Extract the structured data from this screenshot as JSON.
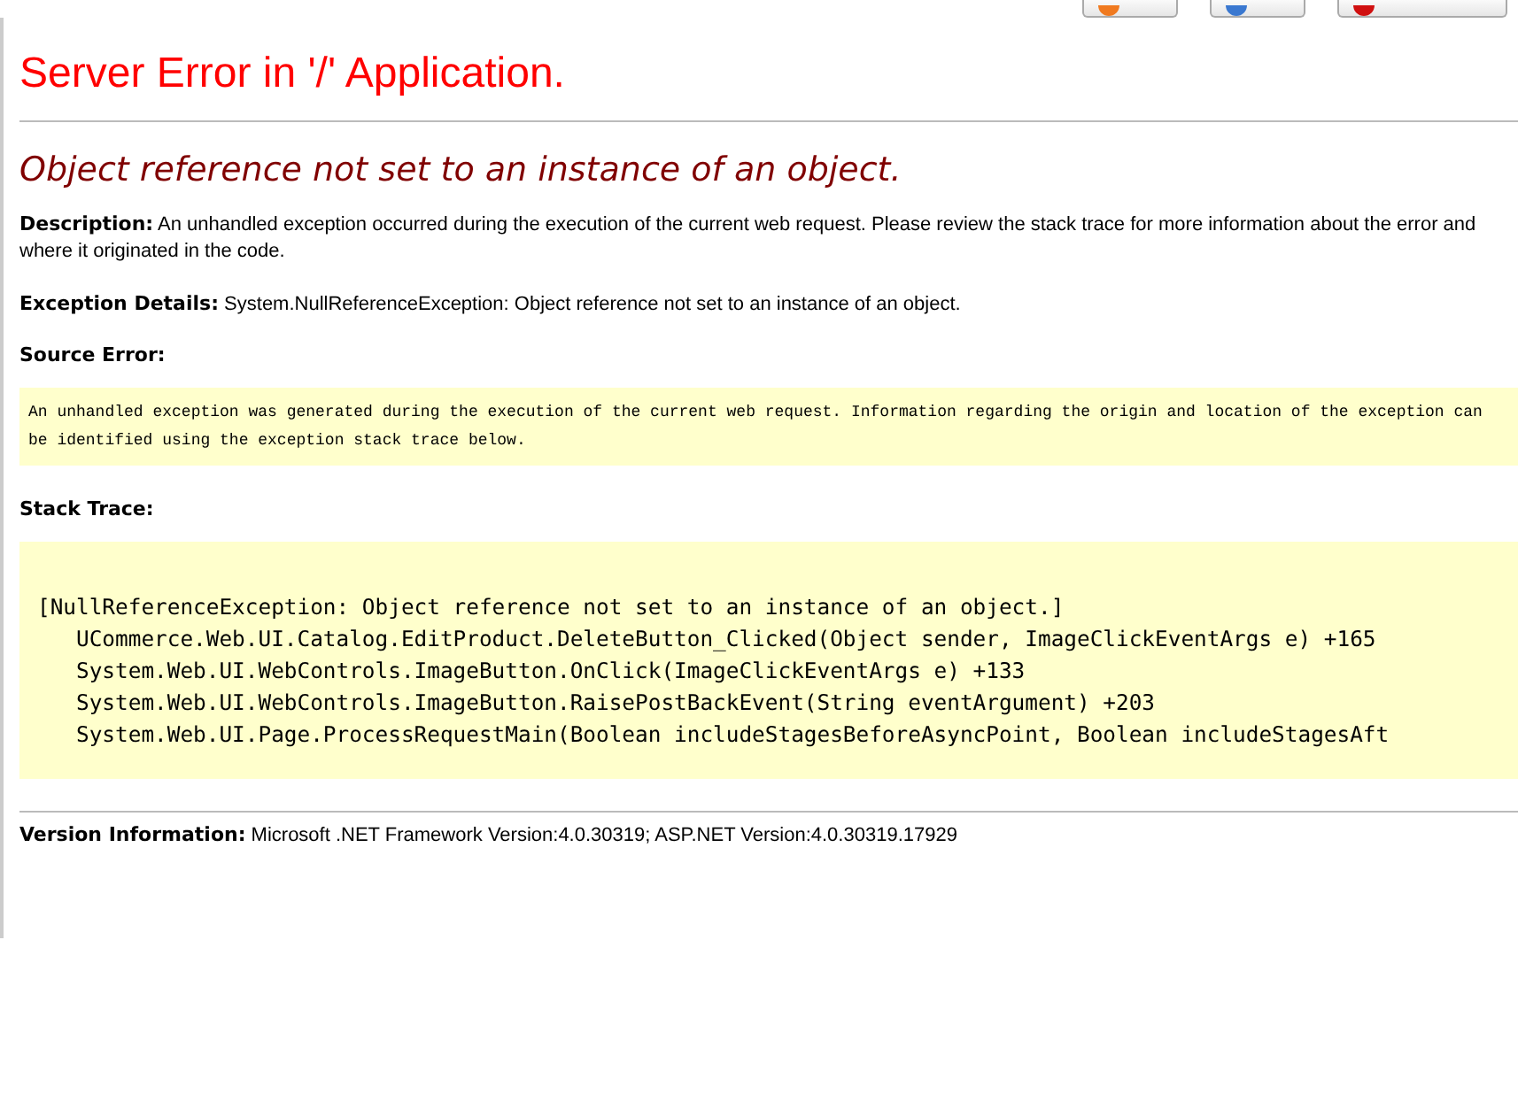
{
  "toolbar": {
    "buttons": [
      {
        "kind": "orange"
      },
      {
        "kind": "blue"
      },
      {
        "kind": "red"
      }
    ]
  },
  "title": "Server Error in '/' Application.",
  "message": "Object reference not set to an instance of an object.",
  "description": {
    "label": "Description:",
    "text": "An unhandled exception occurred during the execution of the current web request. Please review the stack trace for more information about the error and where it originated in the code."
  },
  "exception_details": {
    "label": "Exception Details:",
    "text": "System.NullReferenceException: Object reference not set to an instance of an object."
  },
  "source_error": {
    "label": "Source Error:",
    "text": "An unhandled exception was generated during the execution of the current web request. Information regarding the origin and location of the exception can be identified using the exception stack trace below."
  },
  "stack_trace": {
    "label": "Stack Trace:",
    "lines": [
      "[NullReferenceException: Object reference not set to an instance of an object.]",
      "   UCommerce.Web.UI.Catalog.EditProduct.DeleteButton_Clicked(Object sender, ImageClickEventArgs e) +165",
      "   System.Web.UI.WebControls.ImageButton.OnClick(ImageClickEventArgs e) +133",
      "   System.Web.UI.WebControls.ImageButton.RaisePostBackEvent(String eventArgument) +203",
      "   System.Web.UI.Page.ProcessRequestMain(Boolean includeStagesBeforeAsyncPoint, Boolean includeStagesAft"
    ]
  },
  "version": {
    "label": "Version Information:",
    "text": "Microsoft .NET Framework Version:4.0.30319; ASP.NET Version:4.0.30319.17929"
  }
}
